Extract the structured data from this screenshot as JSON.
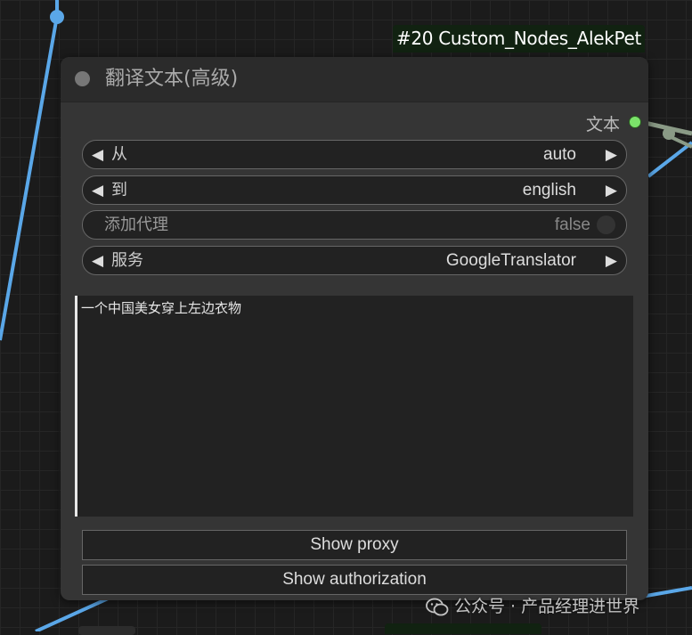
{
  "badge": {
    "label": "#20 Custom_Nodes_AlekPet"
  },
  "node": {
    "title": "翻译文本(高级)",
    "output": {
      "label": "文本"
    },
    "widgets": [
      {
        "label": "从",
        "value": "auto"
      },
      {
        "label": "到",
        "value": "english"
      },
      {
        "label": "添加代理",
        "value": "false"
      },
      {
        "label": "服务",
        "value": "GoogleTranslator"
      }
    ],
    "textarea": {
      "value": "一个中国美女穿上左边衣物"
    },
    "buttons": {
      "show_proxy": "Show proxy",
      "show_authorization": "Show authorization"
    }
  },
  "watermark": {
    "text": "公众号 · 产品经理进世界"
  },
  "colors": {
    "canvas": "#1b1b1b",
    "node_body": "#353535",
    "node_header": "#2b2b2b",
    "wire_blue": "#5aa7e8",
    "wire_gray": "#8a9a86",
    "output_slot": "#7be36a",
    "badge_bg": "#112211"
  }
}
